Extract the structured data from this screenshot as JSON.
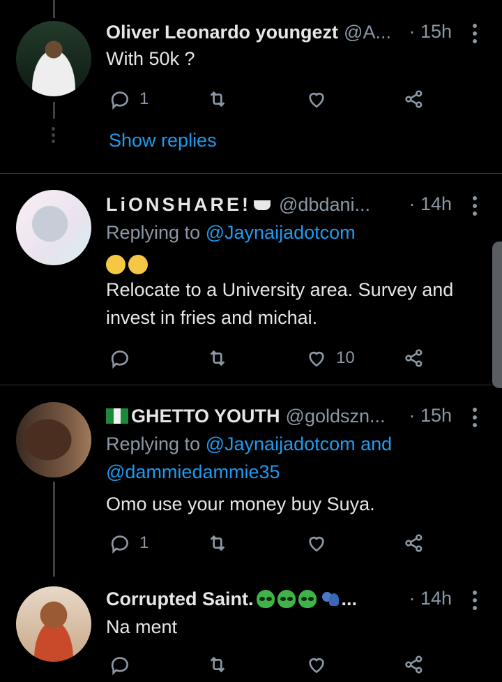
{
  "tweets": [
    {
      "name": "Oliver Leonardo youngezt",
      "handle": "@A...",
      "time": "· 15h",
      "text": "With 50k ?",
      "reply_count": "1",
      "retweet_count": "",
      "like_count": "",
      "avatar_colors": [
        "#1f3a28",
        "#e8e8e8"
      ]
    },
    {
      "name": "LiONSHARE!",
      "handle": "@dbdani...",
      "time": "· 14h",
      "replying_label": "Replying to",
      "replying_to": "@Jaynaijadotcom",
      "emoji": "🤔🤔",
      "text": "Relocate to a University area. Survey and invest in fries and michai.",
      "reply_count": "",
      "retweet_count": "",
      "like_count": "10",
      "avatar_colors": [
        "#f3e6ee",
        "#9aa0a8"
      ]
    },
    {
      "name": "GHETTO YOUTH",
      "handle": "@goldszn...",
      "time": "· 15h",
      "replying_label": "Replying to",
      "replying_to": "@Jaynaijadotcom and",
      "replying_to_2": "@dammiedammie35",
      "text": "Omo use your money buy Suya.",
      "reply_count": "1",
      "retweet_count": "",
      "like_count": "",
      "avatar_colors": [
        "#5a3a2a",
        "#2a1a12"
      ]
    },
    {
      "name": "Corrupted Saint.",
      "handle": "...",
      "time": "· 14h",
      "text": "Na ment",
      "reply_count": "",
      "retweet_count": "",
      "like_count": "",
      "avatar_colors": [
        "#b87a4a",
        "#e8c9a8"
      ]
    }
  ],
  "show_replies_label": "Show replies",
  "colors": {
    "link": "#1d9bf0",
    "muted": "#8b98a5",
    "background": "#000000"
  },
  "icons": [
    "reply-icon",
    "retweet-icon",
    "like-icon",
    "share-icon",
    "more-icon"
  ]
}
